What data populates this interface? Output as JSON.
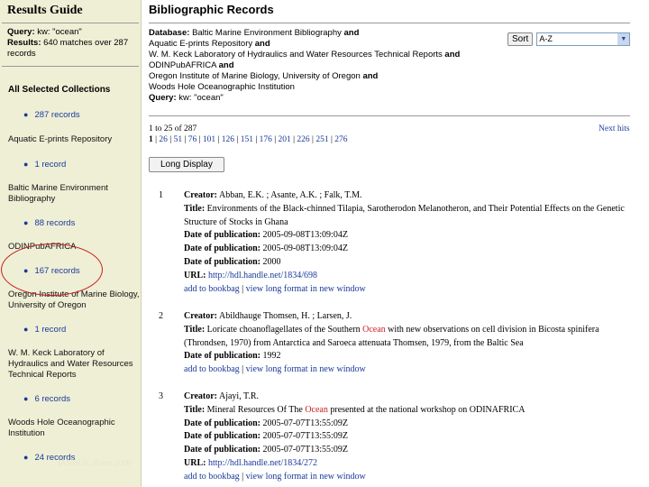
{
  "sidebar": {
    "title": "Results Guide",
    "query_label": "Query:",
    "query_value": "kw: \"ocean\"",
    "results_label": "Results:",
    "results_value": "640 matches over 287 records",
    "all_collections_label": "All Selected Collections",
    "all_collections_count": "287 records",
    "collections": [
      {
        "name": "Aquatic E-prints Repository",
        "count": "1 record"
      },
      {
        "name": "Baltic Marine Environment Bibliography",
        "count": "88 records"
      },
      {
        "name": "ODINPubAFRICA",
        "count": "167 records"
      },
      {
        "name": "Oregon Institute of Marine Biology, University of Oregon",
        "count": "1 record"
      },
      {
        "name": "W. M. Keck Laboratory of Hydraulics and Water Resources Technical Reports",
        "count": "6 records"
      },
      {
        "name": "Woods Hole Oceanographic Institution",
        "count": "24 records"
      }
    ],
    "watermark": "IAMSLIC Rome 2006"
  },
  "main": {
    "title": "Bibliographic Records",
    "database_label": "Database:",
    "database_lines": [
      {
        "text": "Baltic Marine Environment Bibliography",
        "conj": "and"
      },
      {
        "text": "Aquatic E-prints Repository",
        "conj": "and"
      },
      {
        "text": "W. M. Keck Laboratory of Hydraulics and Water Resources Technical Reports",
        "conj": "and"
      },
      {
        "text": "ODINPubAFRICA",
        "conj": "and"
      },
      {
        "text": "Oregon Institute of Marine Biology, University of Oregon",
        "conj": "and"
      },
      {
        "text": "Woods Hole Oceanographic Institution",
        "conj": ""
      }
    ],
    "query_label": "Query:",
    "query_value": "kw: \"ocean\"",
    "sort_button": "Sort",
    "sort_selected": "A-Z",
    "range_text": "1 to 25 of 287",
    "current_page": "1",
    "pages": [
      "26",
      "51",
      "76",
      "101",
      "126",
      "151",
      "176",
      "201",
      "226",
      "251",
      "276"
    ],
    "next_hits": "Next hits",
    "long_display_button": "Long Display"
  },
  "records": [
    {
      "num": "1",
      "creator": "Abban, E.K. ; Asante, A.K. ; Falk, T.M.",
      "title_parts": [
        {
          "text": "Environments of the Black-chinned Tilapia, Sarotherodon Melanotheron, and Their Potential Effects on the Genetic Structure of Stocks in Ghana",
          "hl": false
        }
      ],
      "dates": [
        "2005-09-08T13:09:04Z",
        "2005-09-08T13:09:04Z",
        "2000"
      ],
      "url": "http://hdl.handle.net/1834/698",
      "bookbag": "add to bookbag",
      "sep": "|",
      "long_format": "view long format in new window"
    },
    {
      "num": "2",
      "creator": "Abildhauge Thomsen, H. ; Larsen, J.",
      "title_parts": [
        {
          "text": "Loricate choanoflagellates of the Southern ",
          "hl": false
        },
        {
          "text": "Ocean",
          "hl": true
        },
        {
          "text": " with new observations on cell division in Bicosta spinifera (Throndsen, 1970) from Antarctica and Saroeca attenuata Thomsen, 1979, from the Baltic Sea",
          "hl": false
        }
      ],
      "dates": [
        "1992"
      ],
      "url": "",
      "bookbag": "add to bookbag",
      "sep": "|",
      "long_format": "view long format in new window"
    },
    {
      "num": "3",
      "creator": "Ajayi, T.R.",
      "title_parts": [
        {
          "text": "Mineral Resources Of The ",
          "hl": false
        },
        {
          "text": "Ocean",
          "hl": true
        },
        {
          "text": " presented at the national workshop on ODINAFRICA",
          "hl": false
        }
      ],
      "dates": [
        "2005-07-07T13:55:09Z",
        "2005-07-07T13:55:09Z",
        "2005-07-07T13:55:09Z"
      ],
      "url": "http://hdl.handle.net/1834/272",
      "bookbag": "add to bookbag",
      "sep": "|",
      "long_format": "view long format in new window"
    }
  ],
  "labels": {
    "creator": "Creator:",
    "title": "Title:",
    "date": "Date of publication:",
    "url": "URL:"
  },
  "colors": {
    "sidebar_bg": "#efefd6",
    "link": "#1a3a9a",
    "highlight": "#c81e1e",
    "annotation_oval": "#c62020"
  }
}
